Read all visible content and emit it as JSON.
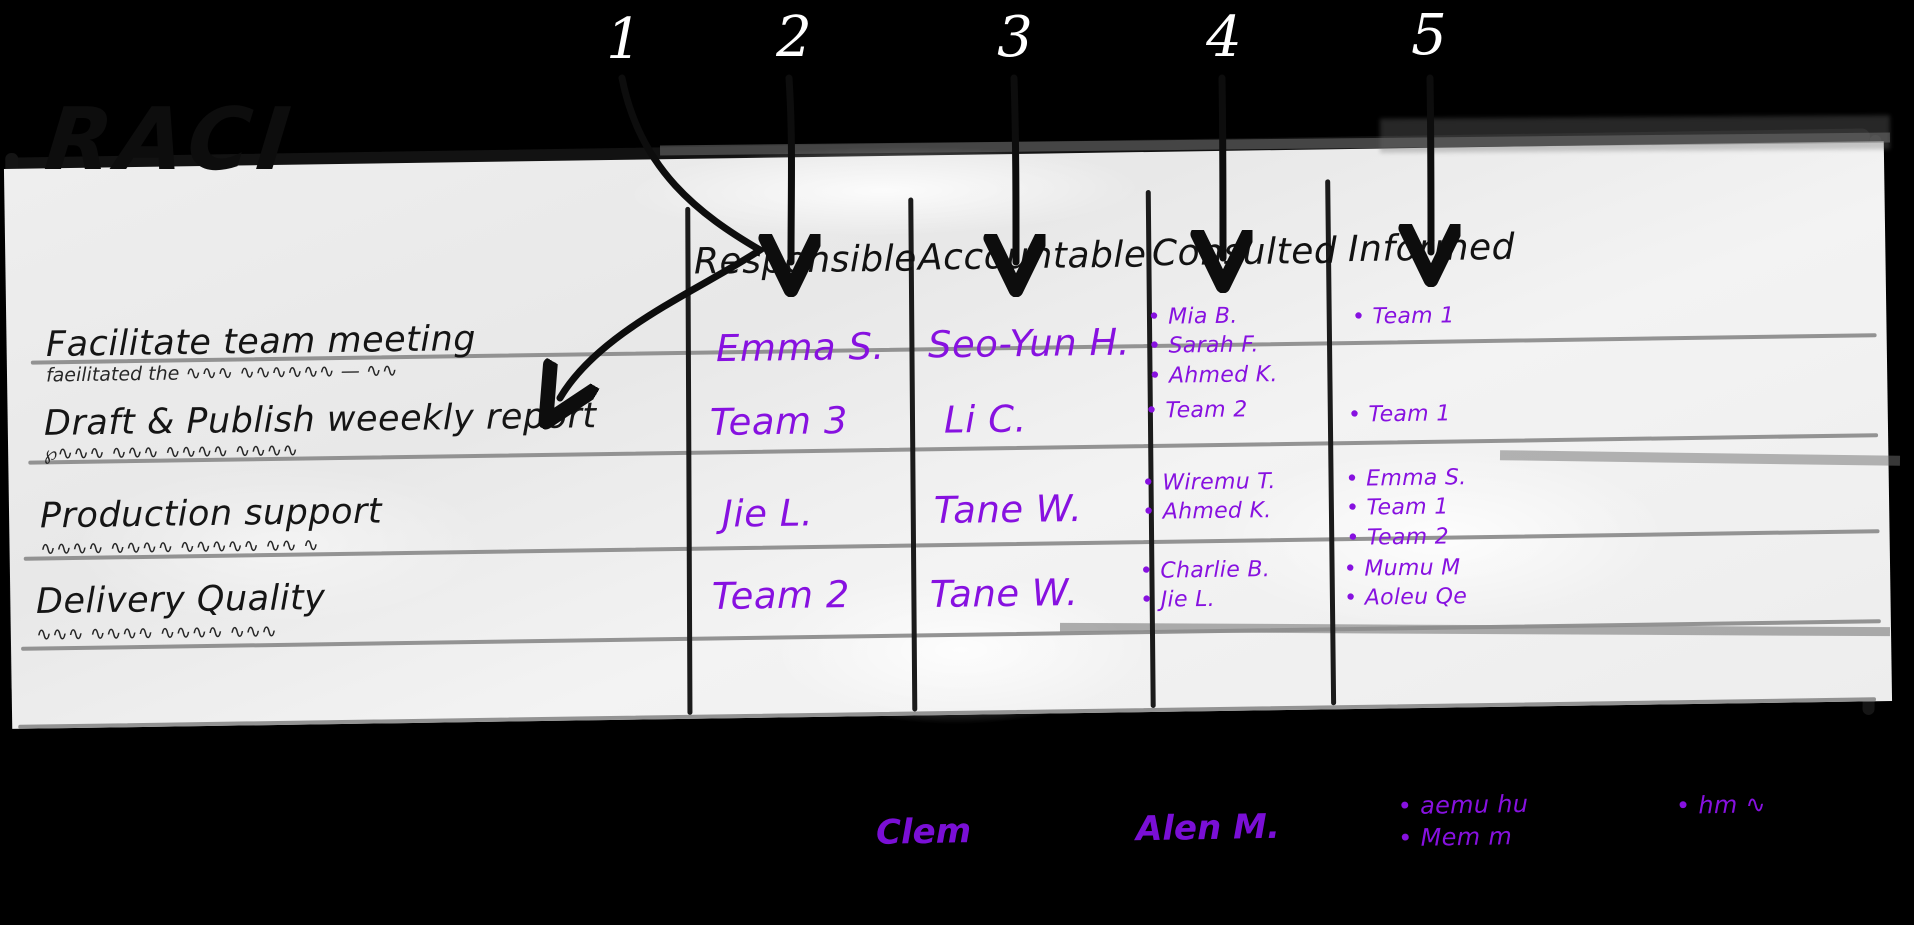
{
  "board": {
    "title": "RACI",
    "accent_purple": "#8711e0",
    "ink_black": "#121212",
    "surface": "#ededed",
    "rule_grey": "#8d8d8d"
  },
  "callouts": [
    {
      "label": "1",
      "target": "task-column"
    },
    {
      "label": "2",
      "target": "responsible-column"
    },
    {
      "label": "3",
      "target": "accountable-column"
    },
    {
      "label": "4",
      "target": "consulted-column"
    },
    {
      "label": "5",
      "target": "informed-column"
    }
  ],
  "columns": [
    {
      "key": "task",
      "label": ""
    },
    {
      "key": "responsible",
      "label": "Responsible"
    },
    {
      "key": "accountable",
      "label": "Accountable"
    },
    {
      "key": "consulted",
      "label": "Consulted"
    },
    {
      "key": "informed",
      "label": "Informed"
    }
  ],
  "rows": [
    {
      "task": "Facilitate team meeting",
      "task_subscribble": "faeilitated the ∿∿∿ ∿∿∿∿∿∿ — ∿∿",
      "responsible": "Emma S.",
      "accountable": "Seo-Yun H.",
      "consulted": [
        "Mia B.",
        "Sarah F.",
        "Ahmed K."
      ],
      "informed": [
        "Team 1"
      ]
    },
    {
      "task": "Draft & Publish  weeekly report",
      "task_subscribble": "℘∿∿∿ ∿∿∿ ∿∿∿∿ ∿∿∿∿",
      "responsible": "Team 3",
      "accountable": "Li C.",
      "consulted": [
        "Team 2"
      ],
      "informed": [
        "Team 1"
      ]
    },
    {
      "task": "Production support",
      "task_subscribble": "∿∿∿∿ ∿∿∿∿ ∿∿∿∿∿ ∿∿ ∿",
      "responsible": "Jie L.",
      "accountable": "Tane W.",
      "consulted": [
        "Wiremu T.",
        "Ahmed K."
      ],
      "informed": [
        "Emma S.",
        "Team 1",
        "Team 2"
      ]
    },
    {
      "task": "Delivery Quality",
      "task_subscribble": "∿∿∿ ∿∿∿∿ ∿∿∿∿ ∿∿∿",
      "responsible": "Team 2",
      "accountable": "Tane W.",
      "consulted": [
        "Charlie B.",
        "Jie L."
      ],
      "informed": [
        "Mumu M",
        "Aoleu Qe"
      ]
    }
  ],
  "cutoff_row": {
    "responsible": "Clem",
    "accountable": "Alen M.",
    "consulted": [
      "aemu hu",
      "Mem m"
    ],
    "informed": [
      "hm ∿"
    ]
  }
}
